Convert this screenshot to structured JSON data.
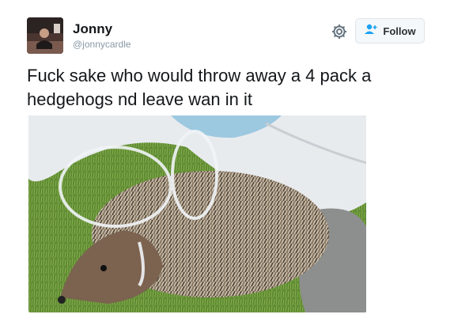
{
  "tweet": {
    "author_name": "Jonny",
    "author_handle": "@jonnycardle",
    "text": "Fuck sake who would throw away a 4 pack a hedgehogs nd leave wan in it"
  },
  "actions": {
    "follow_label": "Follow",
    "settings_icon": "gear-icon",
    "follow_icon": "add-user-icon"
  },
  "colors": {
    "text": "#14171a",
    "handle": "#8899a6",
    "follow_icon": "#1da1f2",
    "button_bg": "#f5f8fa"
  }
}
